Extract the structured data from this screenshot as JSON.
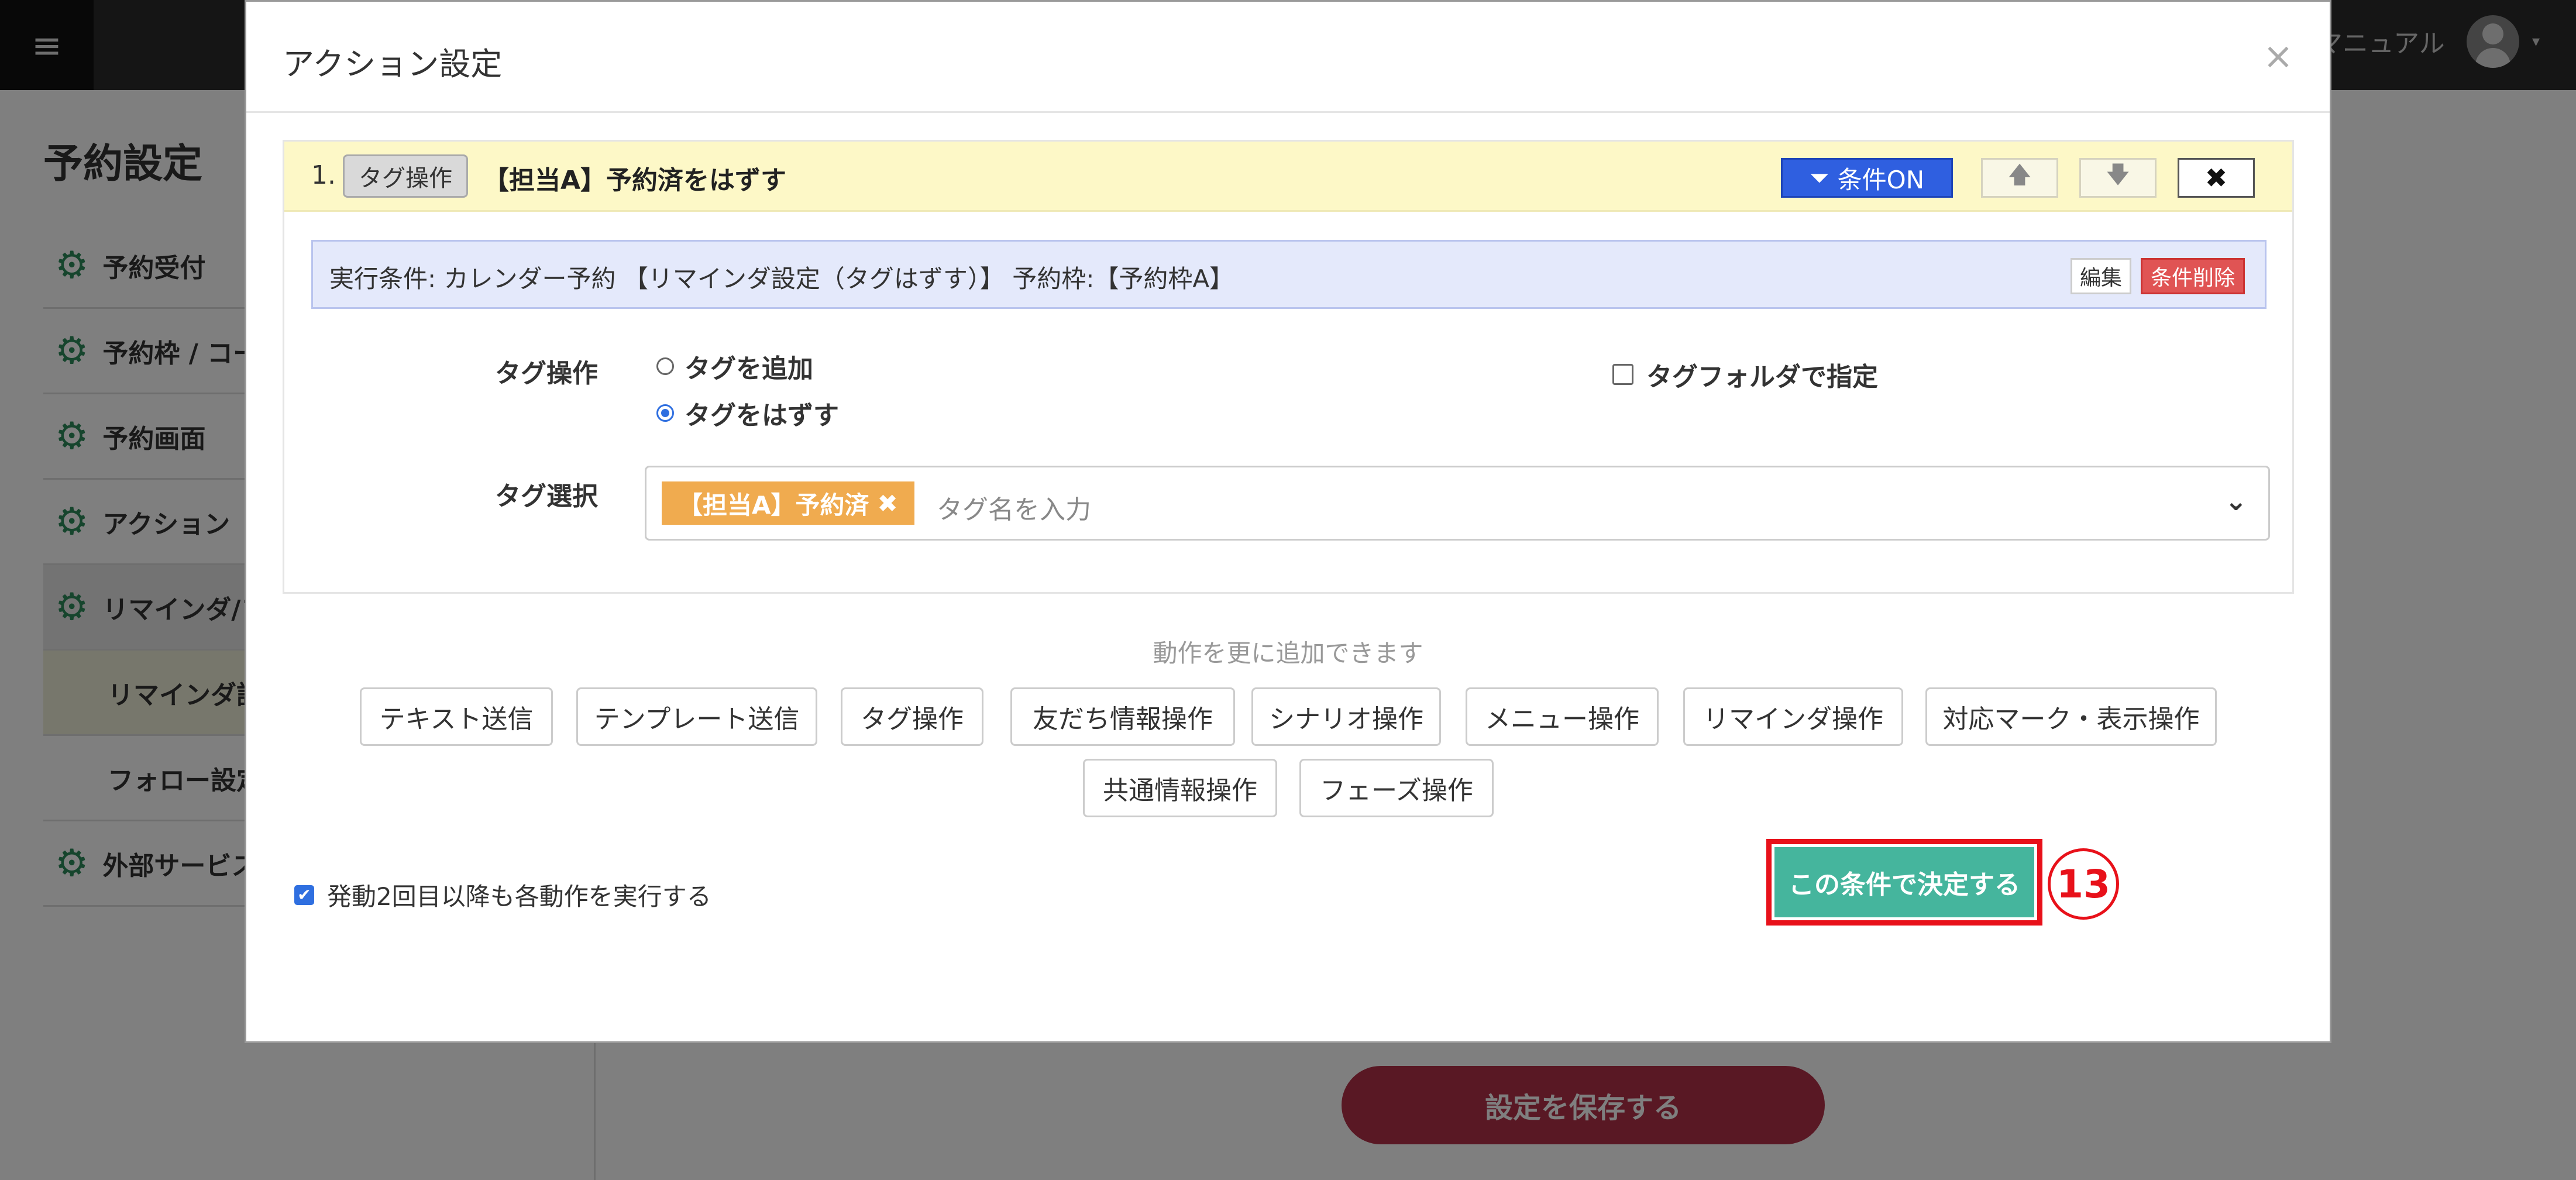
{
  "background": {
    "menu_icon": "hamburger-icon",
    "top_manual": "マニュアル",
    "page_title": "予約設定",
    "sidebar_items": [
      {
        "label": "予約受付"
      },
      {
        "label": "予約枠 / コース"
      },
      {
        "label": "予約画面"
      },
      {
        "label": "アクション"
      },
      {
        "label": "リマインダ/フォロー"
      },
      {
        "label": "リマインダ設定"
      },
      {
        "label": "フォロー設定"
      },
      {
        "label": "外部サービス"
      }
    ],
    "save_button": "設定を保存する"
  },
  "modal": {
    "title": "アクション設定",
    "close": "×",
    "card": {
      "number": "1.",
      "type_chip": "タグ操作",
      "label": "【担当A】予約済をはずす",
      "condition_on": "条件ON",
      "up_arrow": "🡅",
      "down_arrow": "🡇",
      "delete": "✖"
    },
    "condition": {
      "text": "実行条件: カレンダー予約 【リマインダ設定（タグはずす）】 予約枠:【予約枠A】",
      "edit": "編集",
      "delete": "条件削除"
    },
    "tag_operation": {
      "label": "タグ操作",
      "option_add": "タグを追加",
      "option_remove": "タグをはずす",
      "selected": "option_remove",
      "folder_checkbox": "タグフォルダで指定"
    },
    "tag_select": {
      "label": "タグ選択",
      "selected_tag": "【担当A】予約済",
      "remove_glyph": "✖",
      "placeholder": "タグ名を入力",
      "caret": "⌄"
    },
    "add_hint": "動作を更に追加できます",
    "action_buttons": [
      "テキスト送信",
      "テンプレート送信",
      "タグ操作",
      "友だち情報操作",
      "シナリオ操作",
      "メニュー操作",
      "リマインダ操作",
      "対応マーク・表示操作",
      "共通情報操作",
      "フェーズ操作"
    ],
    "repeat_checkbox": "発動2回目以降も各動作を実行する",
    "repeat_checked": true,
    "decide_button": "この条件で決定する",
    "step_marker": "13"
  },
  "colors": {
    "accent_blue": "#2f5fe0",
    "decide_green": "#45b59d",
    "highlight_red": "#e8111a",
    "tag_orange": "#f0ab4f",
    "save_red": "#b33048"
  }
}
